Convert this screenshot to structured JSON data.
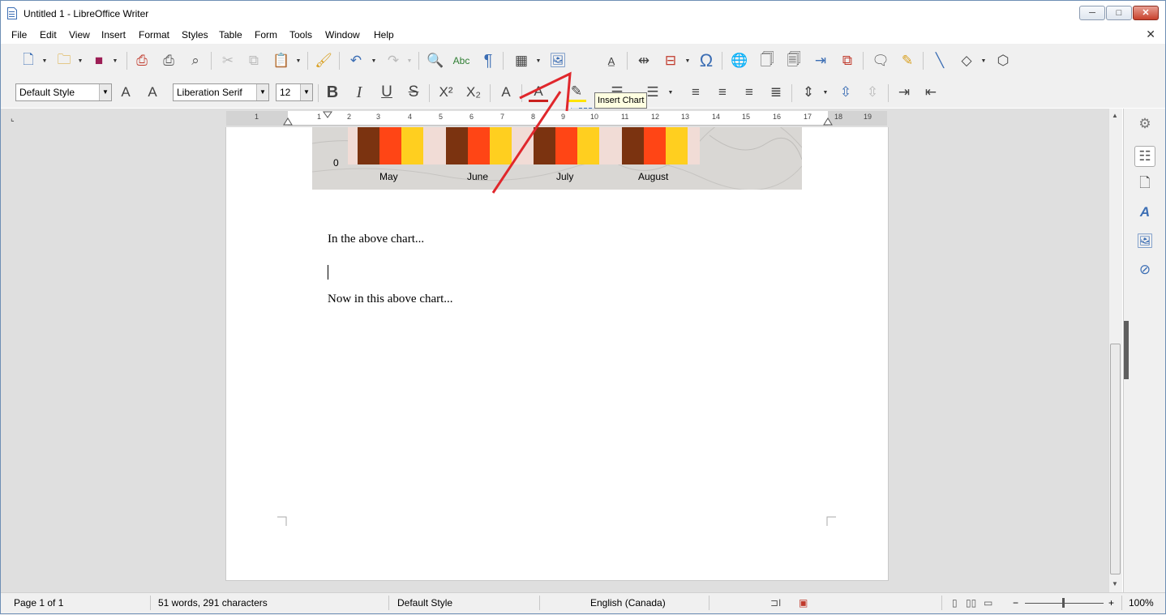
{
  "window": {
    "title": "Untitled 1 - LibreOffice Writer",
    "min": "─",
    "max": "□",
    "close": "✕"
  },
  "menu": [
    "File",
    "Edit",
    "View",
    "Insert",
    "Format",
    "Styles",
    "Table",
    "Form",
    "Tools",
    "Window",
    "Help"
  ],
  "formatting": {
    "para_style": "Default Style",
    "font_name": "Liberation Serif",
    "font_size": "12"
  },
  "tooltip": "Insert Chart",
  "ruler": {
    "numbers": [
      "1",
      "1",
      "2",
      "3",
      "4",
      "5",
      "6",
      "7",
      "8",
      "9",
      "10",
      "11",
      "12",
      "13",
      "14",
      "15",
      "16",
      "17",
      "18",
      "19"
    ]
  },
  "chart_data": {
    "type": "bar",
    "categories": [
      "May",
      "June",
      "July",
      "August"
    ],
    "y_tick_visible": "0",
    "series_colors": [
      "#7b3310",
      "#ff4515",
      "#ffcf1f"
    ]
  },
  "document": {
    "para1": "In the above chart...",
    "para2": "Now in this above chart..."
  },
  "status": {
    "page": "Page 1 of 1",
    "words": "51 words, 291 characters",
    "style": "Default Style",
    "language": "English (Canada)",
    "zoom": "100%"
  },
  "colors": {
    "annotation_arrow": "#e0272c",
    "chart_button_highlight": "#d6e4f4"
  }
}
